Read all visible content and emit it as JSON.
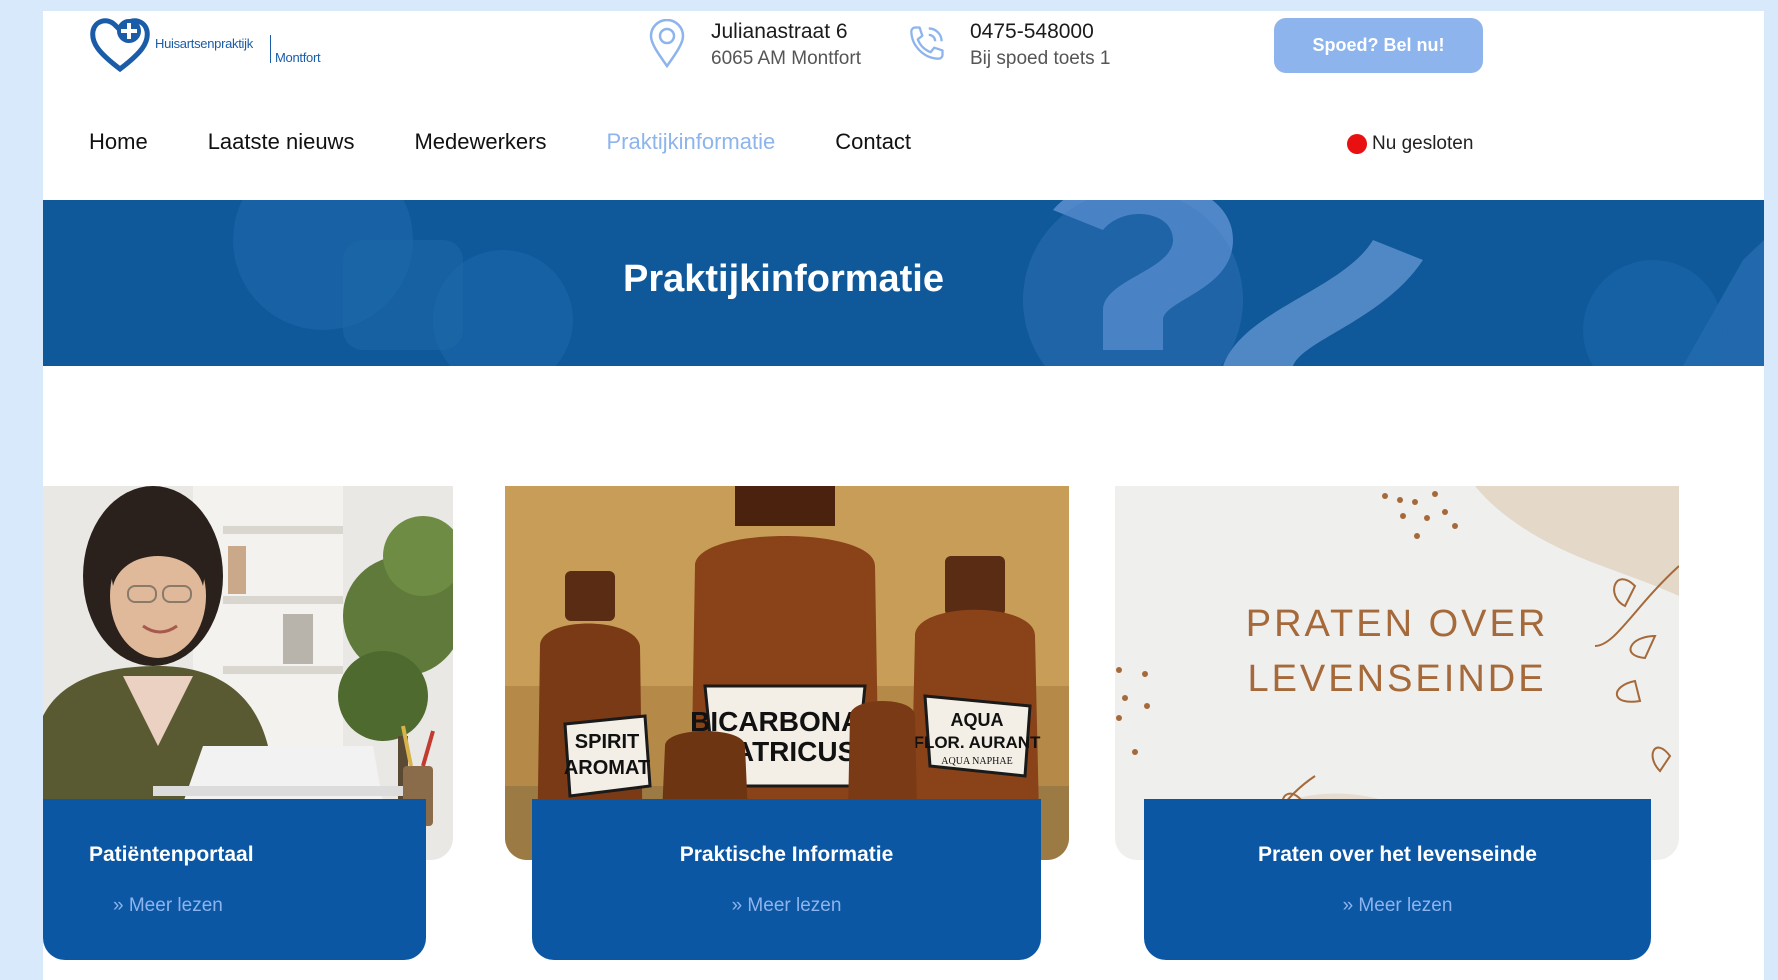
{
  "header": {
    "logo": {
      "name": "Huisartsenpraktijk",
      "town": "Montfort"
    },
    "address": {
      "street": "Julianastraat 6",
      "city": "6065 AM Montfort"
    },
    "phone": {
      "number": "0475-548000",
      "note": "Bij spoed toets 1"
    },
    "emergency_button": "Spoed? Bel nu!"
  },
  "nav": {
    "items": [
      {
        "label": "Home"
      },
      {
        "label": "Laatste nieuws"
      },
      {
        "label": "Medewerkers"
      },
      {
        "label": "Praktijkinformatie"
      },
      {
        "label": "Contact"
      }
    ],
    "active": "Praktijkinformatie"
  },
  "status": {
    "label": "Nu gesloten",
    "color": "#e81010"
  },
  "hero": {
    "title": "Praktijkinformatie"
  },
  "cards": [
    {
      "title": "Patiëntenportaal",
      "link": "Meer lezen"
    },
    {
      "title": "Praktische Informatie",
      "link": "Meer lezen"
    },
    {
      "title": "Praten over het levenseinde",
      "link": "Meer lezen",
      "image_text_line1": "PRATEN OVER",
      "image_text_line2": "LEVENSEINDE"
    }
  ],
  "bottle_labels": {
    "main_line1": "BICARBONAS",
    "main_line2": "NATRICUS",
    "left_line1": "SPIRIT",
    "left_line2": "AROMAT",
    "right_line1": "AQUA",
    "right_line2": "FLOR. AURANT",
    "right_line3": "AQUA NAPHAE"
  },
  "colors": {
    "brand": "#0b57a4",
    "accent": "#8db4ec",
    "status": "#e81010"
  },
  "icons": [
    "heart-cross-logo",
    "location-pin-icon",
    "phone-icon",
    "double-chevron-icon"
  ]
}
